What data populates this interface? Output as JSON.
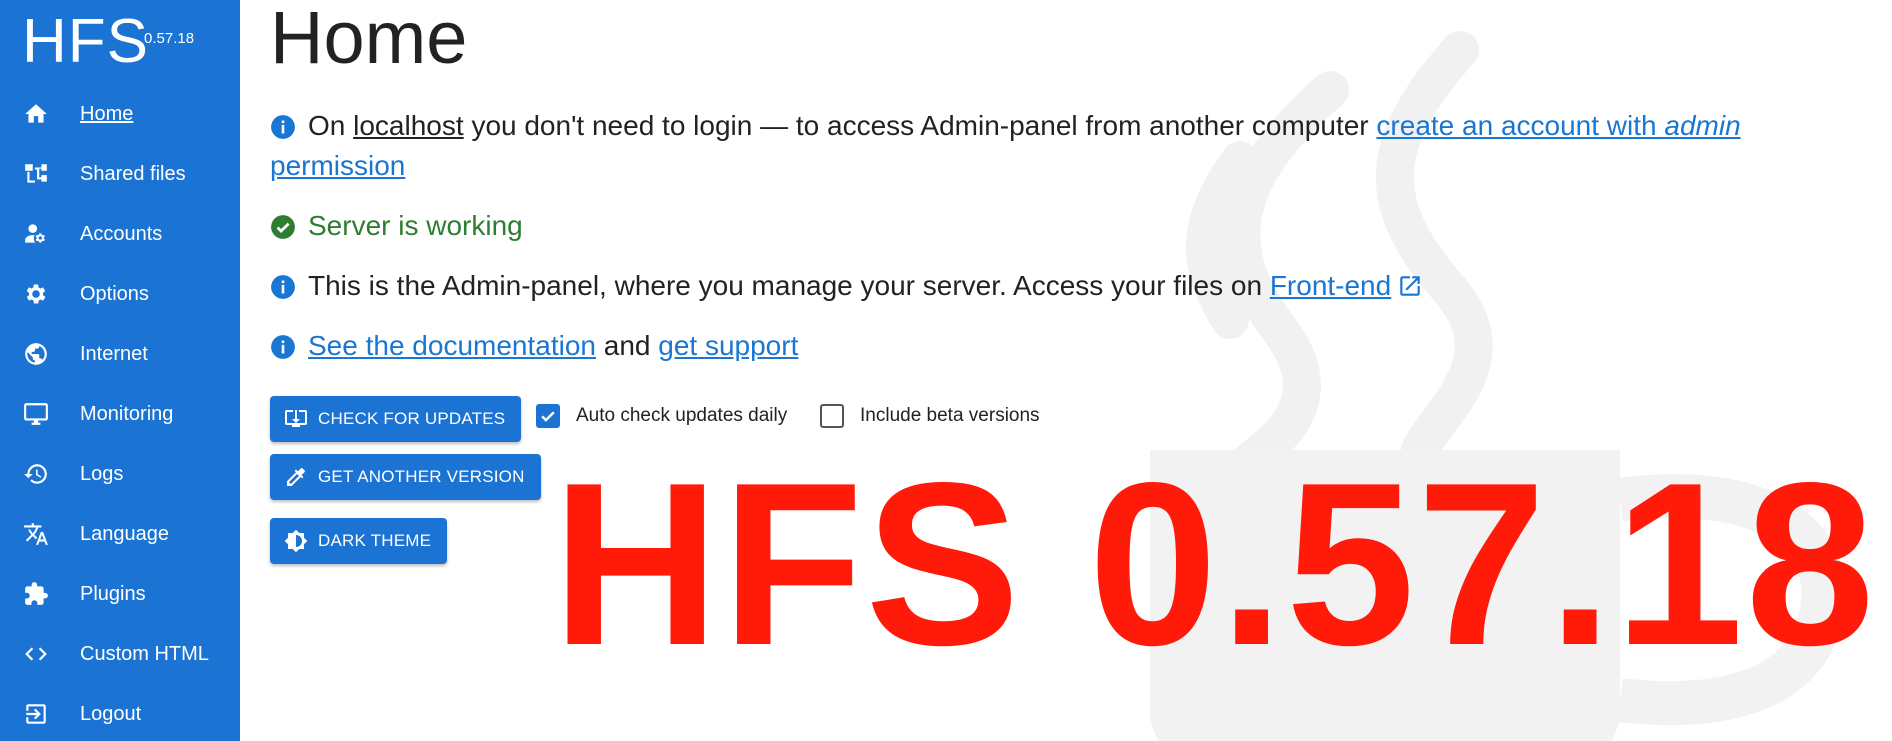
{
  "sidebar": {
    "brand": "HFS",
    "version": "0.57.18",
    "items": [
      {
        "label": "Home",
        "icon": "home-icon"
      },
      {
        "label": "Shared files",
        "icon": "folder-tree-icon"
      },
      {
        "label": "Accounts",
        "icon": "manage-accounts-icon"
      },
      {
        "label": "Options",
        "icon": "gear-icon"
      },
      {
        "label": "Internet",
        "icon": "globe-icon"
      },
      {
        "label": "Monitoring",
        "icon": "monitor-icon"
      },
      {
        "label": "Logs",
        "icon": "history-icon"
      },
      {
        "label": "Language",
        "icon": "translate-icon"
      },
      {
        "label": "Plugins",
        "icon": "puzzle-icon"
      },
      {
        "label": "Custom HTML",
        "icon": "code-icon"
      },
      {
        "label": "Logout",
        "icon": "logout-icon"
      }
    ]
  },
  "main": {
    "title": "Home",
    "login_notice": {
      "prefix": "On",
      "host": "localhost",
      "middle": "you don't need to login — to access Admin-panel from another computer",
      "link_start": "create an account with",
      "link_em": "admin",
      "link_end": "permission"
    },
    "status": "Server is working",
    "admin_notice": {
      "text": "This is the Admin-panel, where you manage your server. Access your files on",
      "link": "Front-end"
    },
    "docs": {
      "link1": "See the documentation",
      "and": "and",
      "link2": "get support"
    },
    "buttons": {
      "check_updates": "CHECK FOR UPDATES",
      "another_version": "GET ANOTHER VERSION",
      "dark_theme": "DARK THEME"
    },
    "checkboxes": {
      "auto_check": {
        "label": "Auto check updates daily",
        "checked": true
      },
      "beta": {
        "label": "Include beta versions",
        "checked": false
      }
    },
    "overlay_text": "HFS 0.57.18"
  },
  "colors": {
    "sidebar": "#1b73d3",
    "link": "#1976d2",
    "success": "#2e7d32",
    "overlay": "#ff1a0a"
  }
}
